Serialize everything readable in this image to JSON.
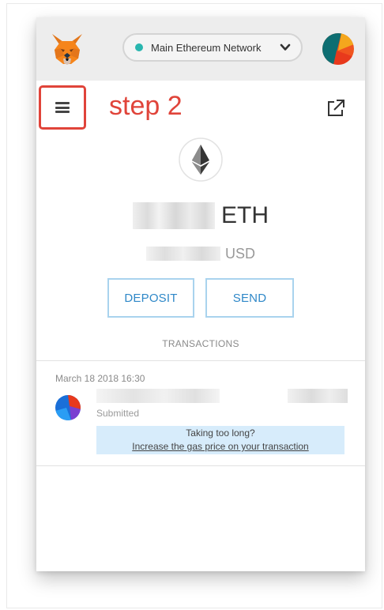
{
  "header": {
    "network_label": "Main Ethereum Network",
    "network_status_color": "#29b6af",
    "logo_icon": "metamask-fox-icon",
    "account_icon": "identicon-avatar-icon",
    "dropdown_icon": "chevron-down-icon"
  },
  "toolbar": {
    "menu_icon": "hamburger-menu-icon",
    "annotation": "step 2",
    "annotation_color": "#e0443a",
    "external_icon": "open-in-new-tab-icon"
  },
  "balance": {
    "token_icon": "ethereum-logo-icon",
    "eth_unit": "ETH",
    "usd_unit": "USD"
  },
  "actions": {
    "deposit_label": "DEPOSIT",
    "send_label": "SEND",
    "accent_color": "#2f88c8"
  },
  "transactions": {
    "heading": "TRANSACTIONS",
    "items": [
      {
        "date": "March 18 2018 16:30",
        "status": "Submitted",
        "alert_title": "Taking too long?",
        "alert_link": "Increase the gas price on your transaction"
      }
    ]
  }
}
